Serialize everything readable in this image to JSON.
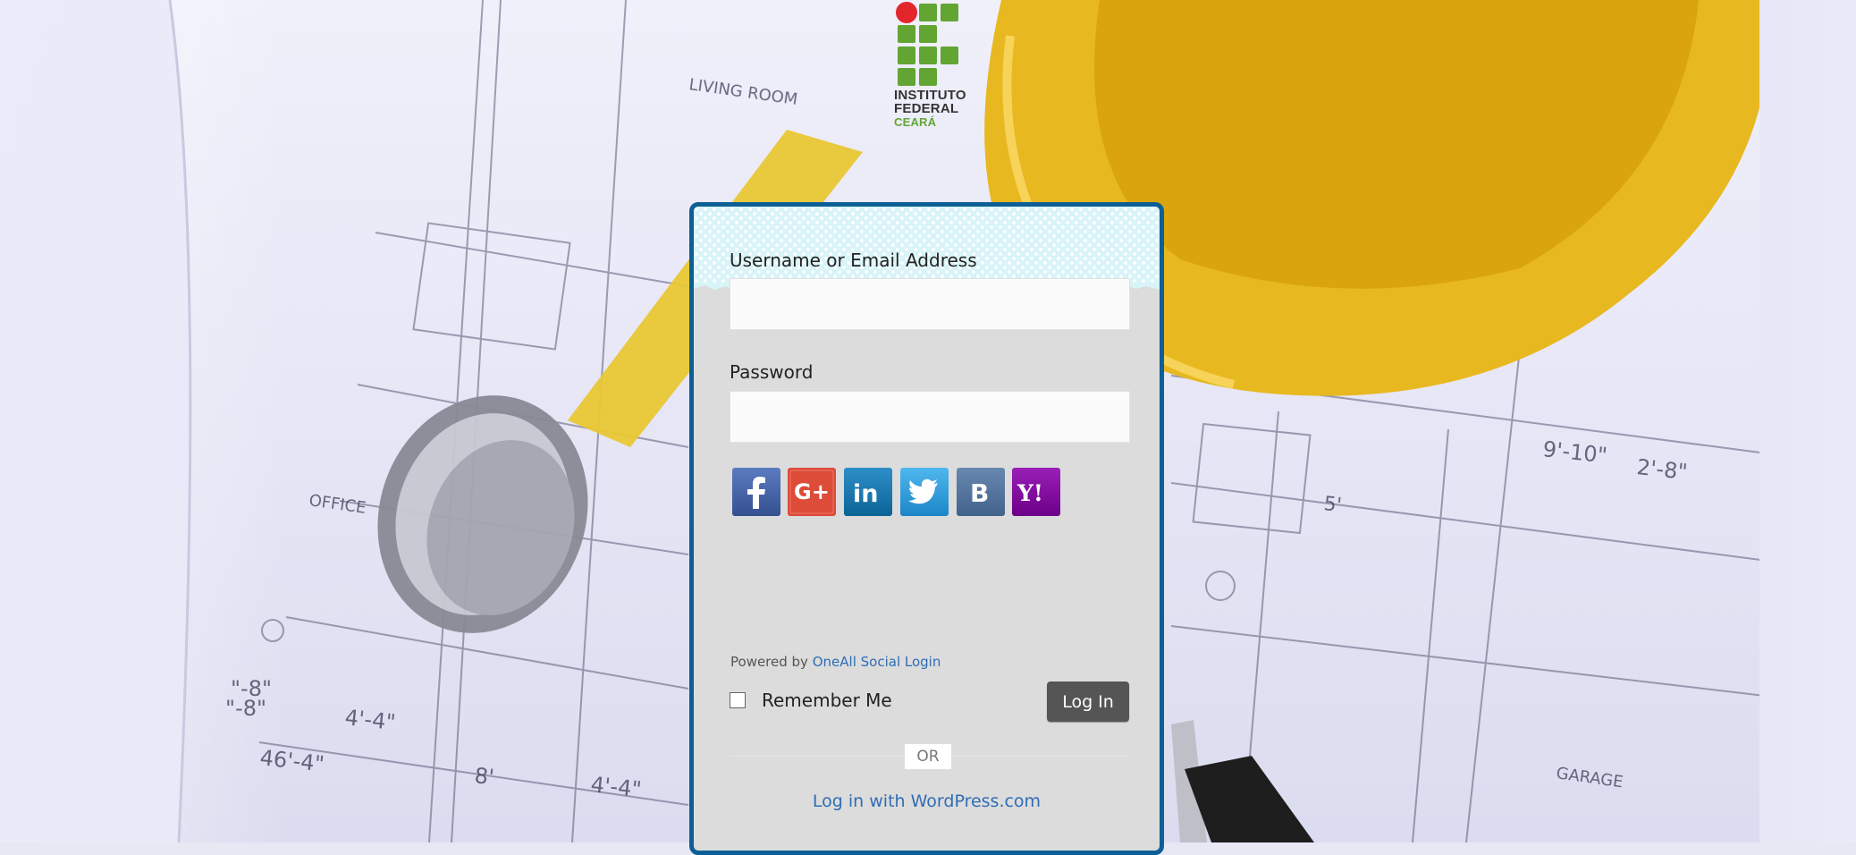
{
  "logo": {
    "line1": "INSTITUTO",
    "line2": "FEDERAL",
    "line3": "CEARÁ"
  },
  "login_form": {
    "username_label": "Username or Email Address",
    "username_value": "",
    "password_label": "Password",
    "password_value": "",
    "social_buttons": [
      {
        "name": "facebook",
        "glyph": "f",
        "color": "#3b5998"
      },
      {
        "name": "google-plus",
        "glyph": "G+",
        "color": "#dd4b39"
      },
      {
        "name": "linkedin",
        "glyph": "in",
        "color": "#0e76a8"
      },
      {
        "name": "twitter",
        "glyph": "bird",
        "color": "#2a9de3"
      },
      {
        "name": "vkontakte",
        "glyph": "B",
        "color": "#4a6d94"
      },
      {
        "name": "yahoo",
        "glyph": "Y!",
        "color": "#7b0099"
      }
    ],
    "powered_by_prefix": "Powered by",
    "powered_by_link": "OneAll Social Login",
    "remember_me_label": "Remember Me",
    "remember_me_checked": false,
    "login_button_label": "Log In",
    "divider_text": "OR",
    "wordpress_link": "Log in with WordPress.com"
  },
  "colors": {
    "card_border": "#0d5f96",
    "card_background": "#dcdcdc",
    "link": "#2f6db5",
    "login_button": "#555555",
    "logo_green": "#62a533",
    "logo_red": "#e3262b"
  }
}
